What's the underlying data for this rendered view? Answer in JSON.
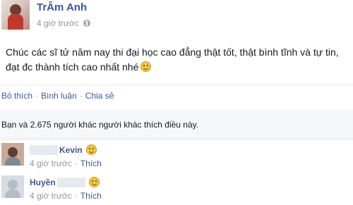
{
  "post": {
    "author": "TrÂm Anh",
    "time": "4 giờ trước",
    "privacy_icon": "globe-icon",
    "text": "Chúc các sĩ tử năm nay thi đại học cao đẳng thật tốt, thật bình tĩnh và tự tin, đạt đc thành tích cao nhất nhé"
  },
  "actions": {
    "like": "Bỏ thích",
    "sep1": "·",
    "comment": "Bình luận",
    "sep2": "·",
    "share": "Chia sẻ"
  },
  "likes_summary": "Bạn và 2.675 người khác người khác thích điều này.",
  "comments": [
    {
      "name": "Kevin",
      "time": "4 giờ trước",
      "like": "Thích",
      "sep": "·"
    },
    {
      "name": "Huyền",
      "time": "4 giờ trước",
      "like": "Thích",
      "sep": "·"
    }
  ]
}
